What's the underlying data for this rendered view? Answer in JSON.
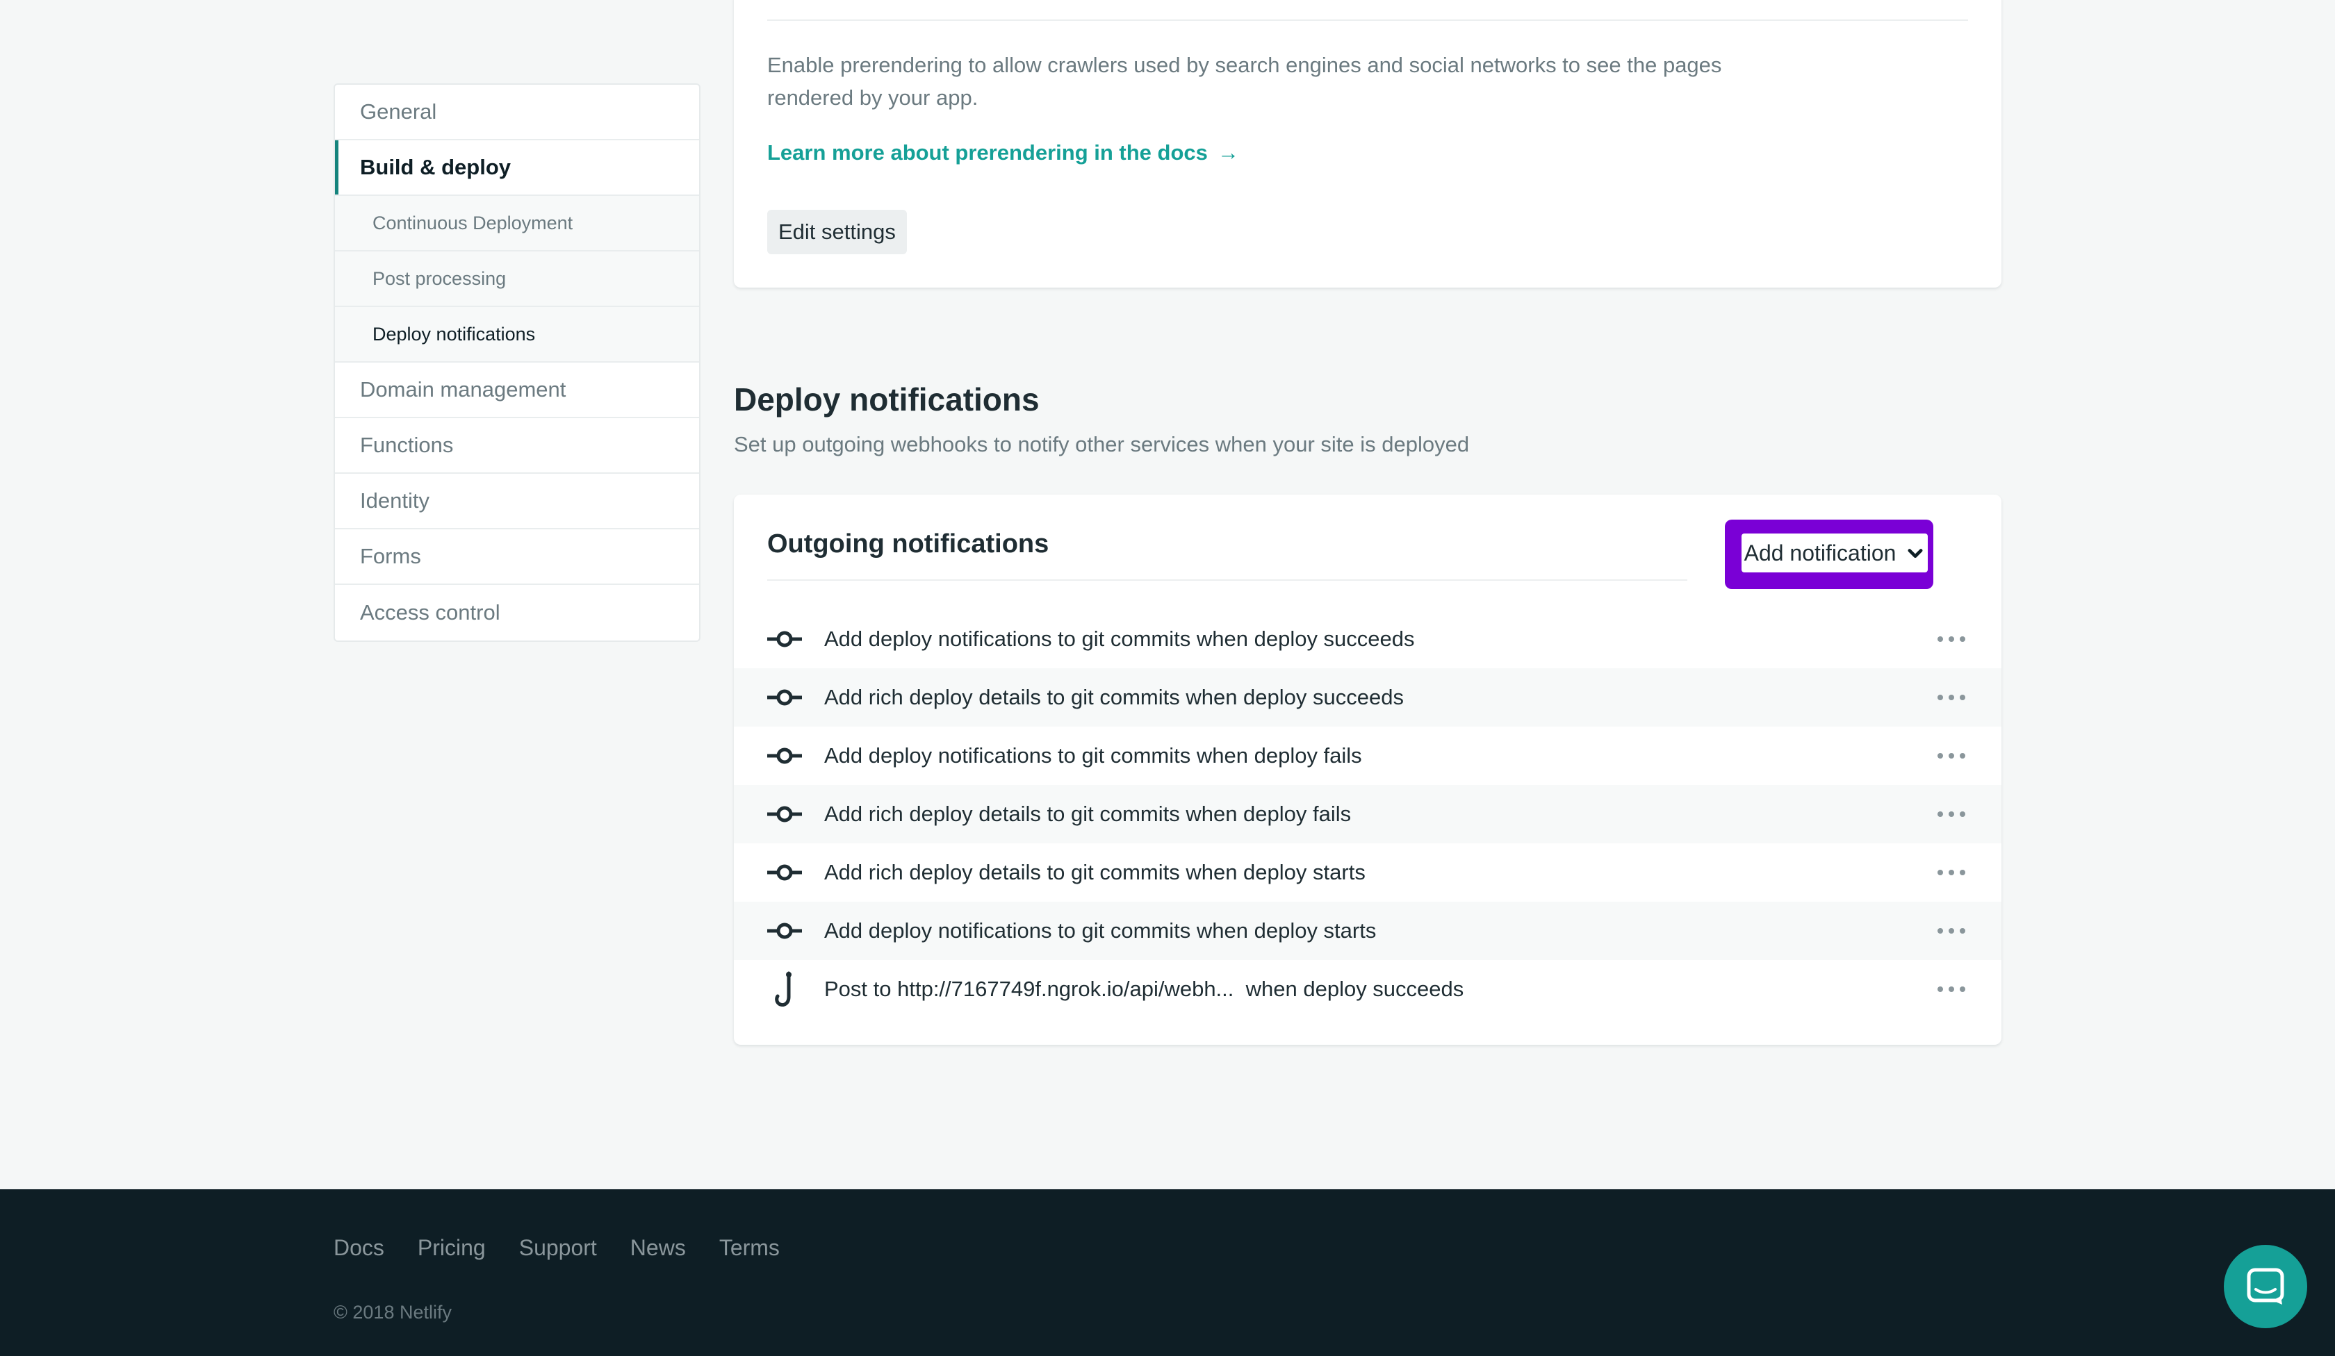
{
  "sidebar": {
    "items": [
      {
        "label": "General"
      },
      {
        "label": "Build & deploy",
        "active": true
      },
      {
        "label": "Continuous Deployment",
        "sub": true
      },
      {
        "label": "Post processing",
        "sub": true
      },
      {
        "label": "Deploy notifications",
        "sub": true,
        "current": true
      },
      {
        "label": "Domain management"
      },
      {
        "label": "Functions"
      },
      {
        "label": "Identity"
      },
      {
        "label": "Forms"
      },
      {
        "label": "Access control"
      }
    ]
  },
  "prerender": {
    "description": "Enable prerendering to allow crawlers used by search engines and social networks to see the pages rendered by your app.",
    "learn_more": "Learn more about prerendering in the docs",
    "learn_more_arrow": "→",
    "edit_button": "Edit settings"
  },
  "deploy_notifications": {
    "title": "Deploy notifications",
    "subtitle": "Set up outgoing webhooks to notify other services when your site is deployed",
    "card_title": "Outgoing notifications",
    "add_button": "Add notification",
    "rows": [
      {
        "icon": "git-commit-icon",
        "text": "Add deploy notifications to git commits when deploy succeeds"
      },
      {
        "icon": "git-commit-icon",
        "text": "Add rich deploy details to git commits when deploy succeeds"
      },
      {
        "icon": "git-commit-icon",
        "text": "Add deploy notifications to git commits when deploy fails"
      },
      {
        "icon": "git-commit-icon",
        "text": "Add rich deploy details to git commits when deploy fails"
      },
      {
        "icon": "git-commit-icon",
        "text": "Add rich deploy details to git commits when deploy starts"
      },
      {
        "icon": "git-commit-icon",
        "text": "Add deploy notifications to git commits when deploy starts"
      },
      {
        "icon": "webhook-icon",
        "text": "Post to http://7167749f.ngrok.io/api/webh...  when deploy succeeds"
      }
    ]
  },
  "footer": {
    "links": [
      "Docs",
      "Pricing",
      "Support",
      "News",
      "Terms"
    ],
    "copyright": "© 2018 Netlify"
  },
  "colors": {
    "accent": "#15a097",
    "highlight": "#7a00d6",
    "footer_bg": "#0e1e25"
  }
}
